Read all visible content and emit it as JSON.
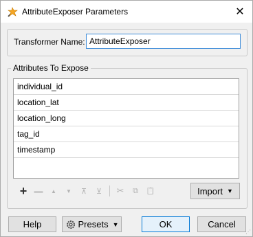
{
  "window": {
    "title": "AttributeExposer Parameters",
    "close_symbol": "✕"
  },
  "transformer": {
    "label": "Transformer Name:",
    "value": "AttributeExposer"
  },
  "attributes": {
    "legend": "Attributes To Expose",
    "items": [
      "individual_id",
      "location_lat",
      "location_long",
      "tag_id",
      "timestamp"
    ]
  },
  "toolbar": {
    "add": "+",
    "remove": "—",
    "move_up": "▲",
    "move_down": "▼",
    "move_top": "⊼",
    "move_bottom": "⊻",
    "cut": "✂",
    "copy": "⧉",
    "paste": "📋",
    "import_label": "Import"
  },
  "buttons": {
    "help": "Help",
    "presets": "Presets",
    "ok": "OK",
    "cancel": "Cancel"
  },
  "icons": {
    "app": "fme-transformer-icon",
    "presets": "gear-icon",
    "caret": "▼"
  }
}
